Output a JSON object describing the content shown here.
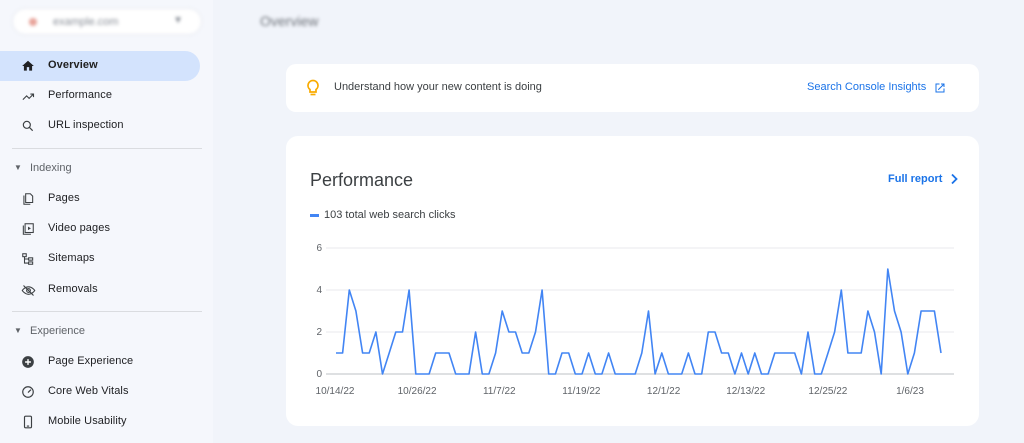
{
  "property": {
    "name": "example.com"
  },
  "header": {
    "title": "Overview"
  },
  "sidebar": {
    "items": [
      {
        "label": "Overview",
        "icon": "home-icon",
        "active": true
      },
      {
        "label": "Performance",
        "icon": "trending-up-icon"
      },
      {
        "label": "URL inspection",
        "icon": "search-icon"
      }
    ],
    "indexing": {
      "label": "Indexing",
      "items": [
        {
          "label": "Pages",
          "icon": "pages-icon"
        },
        {
          "label": "Video pages",
          "icon": "video-pages-icon"
        },
        {
          "label": "Sitemaps",
          "icon": "sitemap-icon"
        },
        {
          "label": "Removals",
          "icon": "eye-off-icon"
        }
      ]
    },
    "experience": {
      "label": "Experience",
      "items": [
        {
          "label": "Page Experience",
          "icon": "plus-circle-icon"
        },
        {
          "label": "Core Web Vitals",
          "icon": "gauge-icon"
        },
        {
          "label": "Mobile Usability",
          "icon": "phone-icon"
        }
      ]
    }
  },
  "insights": {
    "message": "Understand how your new content is doing",
    "link": "Search Console Insights"
  },
  "performance": {
    "title": "Performance",
    "full_report": "Full report",
    "legend": "103 total web search clicks"
  },
  "colors": {
    "accent": "#1a73e8",
    "series": "#4285f4",
    "active_nav": "#d3e3fd",
    "bulb": "#f9ab00"
  },
  "chart_data": {
    "type": "line",
    "y_ticks": [
      "0",
      "2",
      "4",
      "6"
    ],
    "ylim": [
      0,
      6
    ],
    "x_tick_labels": [
      "10/14/22",
      "10/26/22",
      "11/7/22",
      "11/19/22",
      "12/1/22",
      "12/13/22",
      "12/25/22",
      "1/6/23"
    ],
    "grid": true,
    "series": [
      {
        "name": "103 total web search clicks",
        "values": [
          1,
          1,
          4,
          3,
          1,
          1,
          2,
          0,
          1,
          2,
          2,
          4,
          0,
          0,
          0,
          1,
          1,
          1,
          0,
          0,
          0,
          2,
          0,
          0,
          1,
          3,
          2,
          2,
          1,
          1,
          2,
          4,
          0,
          0,
          1,
          1,
          0,
          0,
          1,
          0,
          0,
          1,
          0,
          0,
          0,
          0,
          1,
          3,
          0,
          1,
          0,
          0,
          0,
          1,
          0,
          0,
          2,
          2,
          1,
          1,
          0,
          1,
          0,
          1,
          0,
          0,
          1,
          1,
          1,
          1,
          0,
          2,
          0,
          0,
          1,
          2,
          4,
          1,
          1,
          1,
          3,
          2,
          0,
          5,
          3,
          2,
          0,
          1,
          3,
          3,
          3,
          1
        ]
      }
    ]
  }
}
